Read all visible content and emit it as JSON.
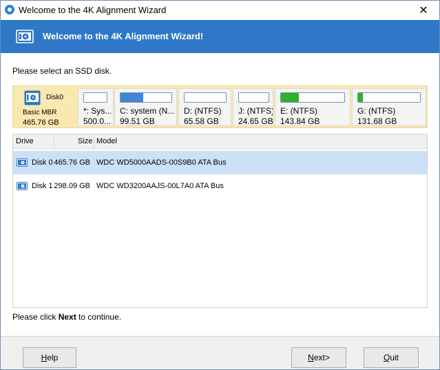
{
  "window": {
    "title": "Welcome to the 4K Alignment Wizard",
    "close_symbol": "✕"
  },
  "banner": {
    "title": "Welcome to the 4K Alignment Wizard!",
    "color": "#2f78c8"
  },
  "prompt": "Please select an SSD disk.",
  "disk_map": {
    "disk_name": "Disk0",
    "disk_type": "Basic MBR",
    "disk_size": "465.76 GB",
    "partitions": [
      {
        "name": "*: Sys...",
        "size": "500.0...",
        "used_fraction": 0.0,
        "fill_color": "#2f78c8"
      },
      {
        "name": "C: system (N...",
        "size": "99.51 GB",
        "used_fraction": 0.45,
        "fill_color": "#3f86d6"
      },
      {
        "name": "D: (NTFS)",
        "size": "65.58 GB",
        "used_fraction": 0.0,
        "fill_color": "#3f86d6"
      },
      {
        "name": "J: (NTFS)",
        "size": "24.65 GB",
        "used_fraction": 0.0,
        "fill_color": "#3f86d6"
      },
      {
        "name": "E: (NTFS)",
        "size": "143.84 GB",
        "used_fraction": 0.28,
        "fill_color": "#2fb02f"
      },
      {
        "name": "G: (NTFS)",
        "size": "131.68 GB",
        "used_fraction": 0.08,
        "fill_color": "#2fb02f"
      }
    ]
  },
  "table": {
    "columns": [
      "Drive",
      "Size",
      "Model"
    ],
    "rows": [
      {
        "drive": "Disk 0",
        "size": "465.76 GB",
        "model": "WDC WD5000AADS-00S9B0 ATA Bus",
        "selected": true
      },
      {
        "drive": "Disk 1",
        "size": "298.09 GB",
        "model": "WDC WD3200AAJS-00L7A0 ATA Bus",
        "selected": false
      }
    ]
  },
  "hint": {
    "before": "Please click ",
    "bold": "Next",
    "after": " to continue."
  },
  "buttons": {
    "help": {
      "accel": "H",
      "rest": "elp"
    },
    "next": {
      "accel": "N",
      "rest": "ext>"
    },
    "quit": {
      "accel": "Q",
      "rest": "uit"
    }
  },
  "icons": {
    "app": "app-disc-icon",
    "banner": "disk-drive-icon",
    "row": "hard-disk-icon"
  }
}
